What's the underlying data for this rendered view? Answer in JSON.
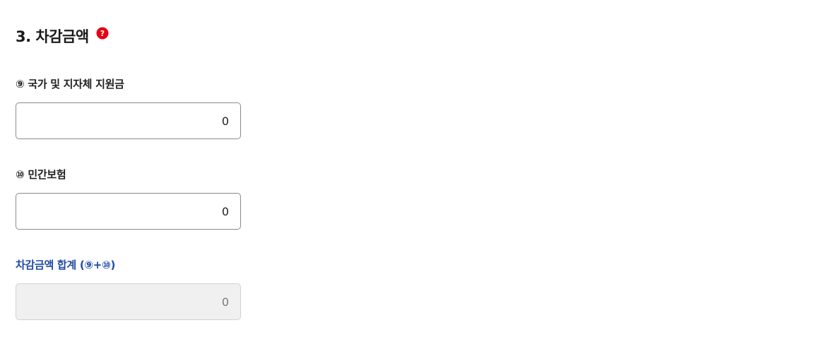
{
  "section": {
    "title": "3. 차감금액",
    "help_icon": "question-mark-circle-icon",
    "help_icon_color": "#e60012"
  },
  "fields": {
    "gov_support": {
      "label": "⑨ 국가 및 지자체 지원금",
      "value": "0"
    },
    "private_insurance": {
      "label": "⑩ 민간보험",
      "value": "0"
    },
    "deduction_total": {
      "label": "차감금액 합계 (⑨+⑩)",
      "value": "0"
    }
  },
  "colors": {
    "sum_label": "#1f4aa3",
    "readonly_bg": "#f0f0f0",
    "input_border": "#8a8a8a"
  }
}
